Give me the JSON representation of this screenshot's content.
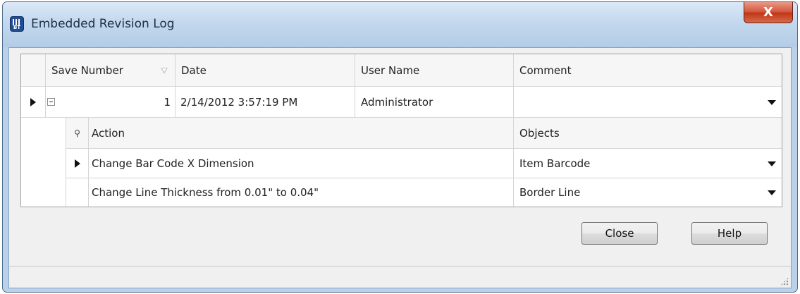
{
  "window": {
    "title": "Embedded Revision Log",
    "app_icon_text": "BT",
    "close_label": "X"
  },
  "grid": {
    "columns": [
      "Save Number",
      "Date",
      "User Name",
      "Comment"
    ],
    "rows": [
      {
        "save_number": "1",
        "date": "2/14/2012 3:57:19 PM",
        "user_name": "Administrator",
        "comment": "",
        "expanded": true,
        "detail": {
          "columns": [
            "Action",
            "Objects"
          ],
          "rows": [
            {
              "action": "Change Bar Code X Dimension",
              "objects": "Item Barcode",
              "current": true
            },
            {
              "action": "Change Line Thickness from 0.01\" to 0.04\"",
              "objects": "Border Line",
              "current": false
            }
          ]
        }
      }
    ]
  },
  "buttons": {
    "close": "Close",
    "help": "Help"
  },
  "icons": {
    "app": "bartender-icon",
    "row_indicator": "row-pointer-icon",
    "collapse": "collapse-minus-icon",
    "sort": "sort-descending-icon",
    "search": "search-icon",
    "dropdown": "chevron-down-icon",
    "grip": "resize-grip-icon"
  }
}
